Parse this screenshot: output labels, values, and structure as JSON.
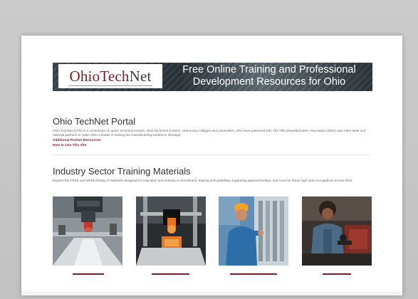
{
  "banner": {
    "logo_text_ohio": "Ohio",
    "logo_text_tech": "Tech",
    "logo_text_net": "Net",
    "title_line1": "Free Online Training and Professional",
    "title_line2": "Development Resources for Ohio"
  },
  "portal": {
    "heading": "Ohio TechNet Portal",
    "description": "Ohio TechNet (OTN) is a consortium of career technical centers, Ohio Technical Centers, community colleges and universities, who have partnered with The Ohio Manufacturers' Association (OMA) and other state and national partners to make Ohio a leader in solving the manufacturing workforce shortage.",
    "links": [
      "Additional Partner Resources",
      "How to Use This Site"
    ]
  },
  "industry": {
    "heading": "Industry Sector Training Materials",
    "description": "Explore the FREE and OPEN library of materials designed for education and industry in recruitment, training and upskilling, supporting apprenticeships, and more for these high need occupations across Ohio."
  },
  "cards": [
    {
      "icon": "cnc-machine-image"
    },
    {
      "icon": "3d-printer-image"
    },
    {
      "icon": "industrial-worker-image"
    },
    {
      "icon": "welder-worker-image"
    }
  ],
  "colors": {
    "brand": "#7b1c2a",
    "banner_dark": "#2b3339",
    "text": "#333333"
  }
}
